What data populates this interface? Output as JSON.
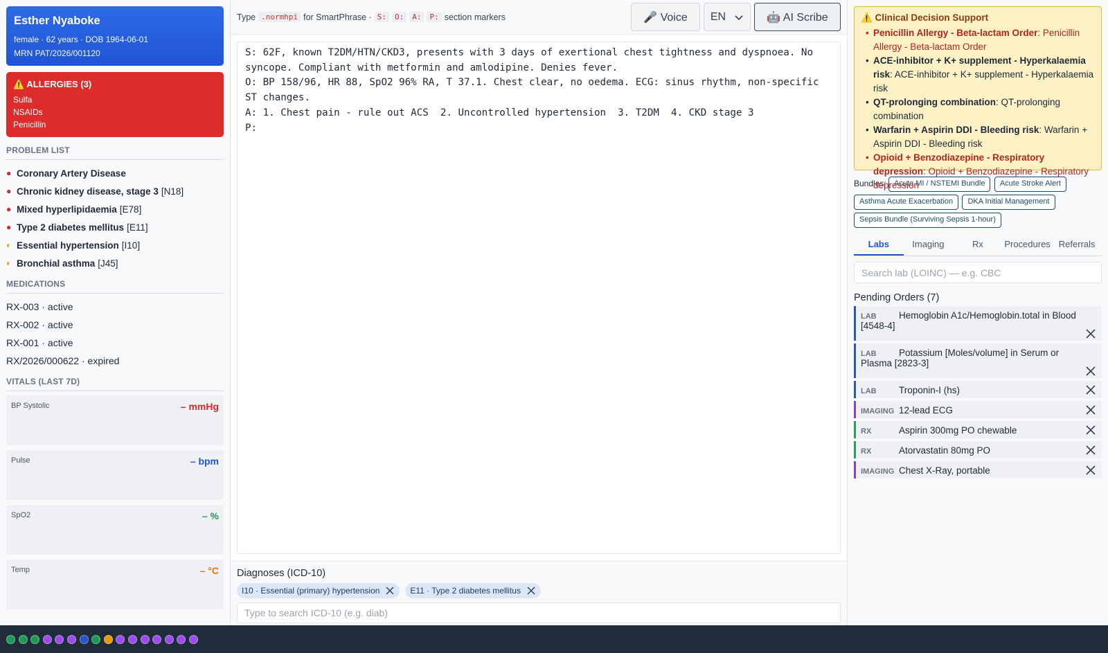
{
  "patient": {
    "name": "Esther Nyaboke",
    "demographics": "female · 62 years · DOB 1964-06-01",
    "mrn": "MRN PAT/2026/001120"
  },
  "allergies": {
    "title": "⚠️ ALLERGIES (3)",
    "items": [
      "Sulfa",
      "NSAIDs",
      "Penicillin"
    ]
  },
  "problem_list": {
    "title": "PROBLEM LIST",
    "items": [
      {
        "marker": "●",
        "severity": "red",
        "name": "Coronary Artery Disease",
        "code": ""
      },
      {
        "marker": "●",
        "severity": "red",
        "name": "Chronic kidney disease, stage 3",
        "code": "[N18]"
      },
      {
        "marker": "●",
        "severity": "red",
        "name": "Mixed hyperlipidaemia",
        "code": "[E78]"
      },
      {
        "marker": "●",
        "severity": "red",
        "name": "Type 2 diabetes mellitus",
        "code": "[E11]"
      },
      {
        "marker": "◐",
        "severity": "half",
        "name": "Essential hypertension",
        "code": "[I10]"
      },
      {
        "marker": "◐",
        "severity": "half",
        "name": "Bronchial asthma",
        "code": "[J45]"
      }
    ]
  },
  "medications": {
    "title": "MEDICATIONS",
    "items": [
      "RX-003 · active",
      "RX-002 · active",
      "RX-001 · active",
      "RX/2026/000622 · expired"
    ]
  },
  "vitals": {
    "title": "VITALS (LAST 7D)",
    "items": [
      {
        "label": "BP Systolic",
        "value": "– mmHg",
        "color": "#d62828"
      },
      {
        "label": "Pulse",
        "value": "– bpm",
        "color": "#2456c8"
      },
      {
        "label": "SpO2",
        "value": "– %",
        "color": "#1f9a55"
      },
      {
        "label": "Temp",
        "value": "– °C",
        "color": "#e8760c"
      }
    ]
  },
  "toolbar": {
    "hint_prefix": "Type",
    "smartphrase": ".normhpi",
    "hint_mid": "for SmartPhrase ·",
    "markers": [
      "S:",
      "O:",
      "A:",
      "P:"
    ],
    "hint_suffix": "section markers",
    "voice_label": "🎤 Voice",
    "lang_label": "EN",
    "scribe_label": "🤖 AI Scribe"
  },
  "note_text": "S: 62F, known T2DM/HTN/CKD3, presents with 3 days of exertional chest tightness and dyspnoea. No syncope. Compliant with metformin and amlodipine. Denies fever.\nO: BP 158/96, HR 88, SpO2 96% RA, T 37.1. Chest clear, no oedema. ECG: sinus rhythm, non-specific ST changes.\nA: 1. Chest pain - rule out ACS  2. Uncontrolled hypertension  3. T2DM  4. CKD stage 3\nP: ",
  "diagnoses": {
    "title": "Diagnoses (ICD-10)",
    "chips": [
      "I10 · Essential (primary) hypertension",
      "E11 · Type 2 diabetes mellitus"
    ],
    "placeholder": "Type to search ICD-10 (e.g. diab)"
  },
  "cds": {
    "title": "⚠️ Clinical Decision Support",
    "alerts": [
      {
        "severity": "high",
        "name": "Penicillin Allergy - Beta-lactam Order",
        "detail": "Penicillin Allergy - Beta-lactam Order"
      },
      {
        "severity": "mod",
        "name": "ACE-inhibitor + K+ supplement - Hyperkalaemia risk",
        "detail": "ACE-inhibitor + K+ supplement - Hyperkalaemia risk"
      },
      {
        "severity": "mod",
        "name": "QT-prolonging combination",
        "detail": "QT-prolonging combination"
      },
      {
        "severity": "mod",
        "name": "Warfarin + Aspirin DDI - Bleeding risk",
        "detail": "Warfarin + Aspirin DDI - Bleeding risk"
      },
      {
        "severity": "high",
        "name": "Opioid + Benzodiazepine - Respiratory depression",
        "detail": "Opioid + Benzodiazepine - Respiratory depression"
      }
    ]
  },
  "bundles": {
    "label": "Bundles:",
    "items": [
      "Acute MI / NSTEMI Bundle",
      "Acute Stroke Alert",
      "Asthma Acute Exacerbation",
      "DKA Initial Management",
      "Sepsis Bundle (Surviving Sepsis 1-hour)"
    ]
  },
  "order_tabs": {
    "active": "Labs",
    "items": [
      "Labs",
      "Imaging",
      "Rx",
      "Procedures",
      "Referrals"
    ]
  },
  "lab_search": {
    "placeholder": "Search lab (LOINC) — e.g. CBC"
  },
  "pending_orders": {
    "title": "Pending Orders (7)",
    "items": [
      {
        "kind": "LAB",
        "type": "lab",
        "text": "Hemoglobin A1c/Hemoglobin.total in Blood [4548-4]"
      },
      {
        "kind": "LAB",
        "type": "lab",
        "text": "Potassium [Moles/volume] in Serum or Plasma [2823-3]"
      },
      {
        "kind": "LAB",
        "type": "lab",
        "text": "Troponin-I (hs)"
      },
      {
        "kind": "IMAGING",
        "type": "img",
        "text": "12-lead ECG"
      },
      {
        "kind": "RX",
        "type": "rx",
        "text": "Aspirin 300mg PO chewable"
      },
      {
        "kind": "RX",
        "type": "rx",
        "text": "Atorvastatin 80mg PO"
      },
      {
        "kind": "IMAGING",
        "type": "img",
        "text": "Chest X-Ray, portable"
      }
    ]
  },
  "status_dots": [
    "#1f9a55",
    "#1f9a55",
    "#1f9a55",
    "#9b4de8",
    "#9b4de8",
    "#9b4de8",
    "#2456c8",
    "#1f9a55",
    "#e89a0c",
    "#9b4de8",
    "#9b4de8",
    "#9b4de8",
    "#9b4de8",
    "#9b4de8",
    "#9b4de8",
    "#9b4de8"
  ]
}
